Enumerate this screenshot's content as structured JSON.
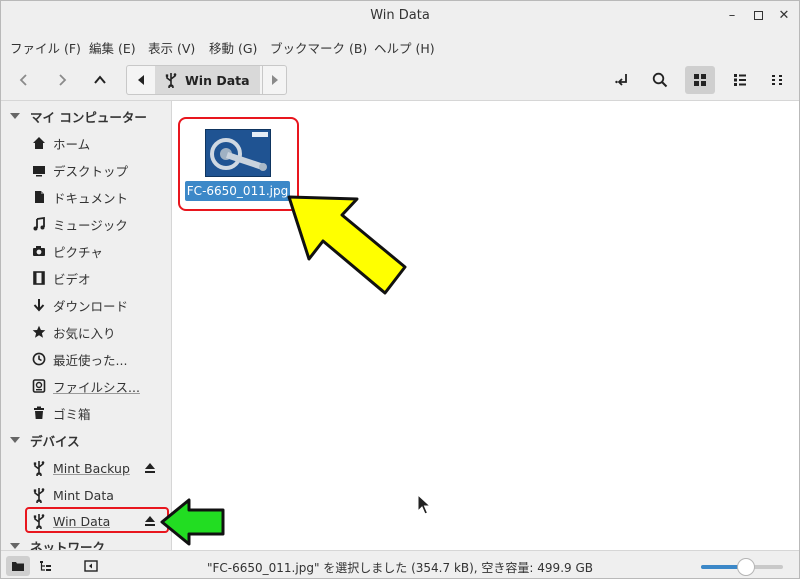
{
  "window": {
    "title": "Win Data"
  },
  "menubar": {
    "items": [
      "ファイル (F)",
      "編集 (E)",
      "表示 (V)",
      "移動 (G)",
      "ブックマーク (B)",
      "ヘルプ (H)"
    ]
  },
  "toolbar": {
    "path": {
      "current": "Win Data"
    }
  },
  "sidebar": {
    "sections": [
      {
        "title": "マイ コンピューター"
      },
      {
        "title": "デバイス"
      },
      {
        "title": "ネットワーク"
      }
    ],
    "places": [
      {
        "label": "ホーム",
        "icon": "home-icon"
      },
      {
        "label": "デスクトップ",
        "icon": "desktop-icon"
      },
      {
        "label": "ドキュメント",
        "icon": "document-icon"
      },
      {
        "label": "ミュージック",
        "icon": "music-icon"
      },
      {
        "label": "ピクチャ",
        "icon": "camera-icon"
      },
      {
        "label": "ビデオ",
        "icon": "video-icon"
      },
      {
        "label": "ダウンロード",
        "icon": "download-icon"
      },
      {
        "label": "お気に入り",
        "icon": "star-icon"
      },
      {
        "label": "最近使った...",
        "icon": "clock-icon"
      },
      {
        "label": "ファイルシス...",
        "icon": "drive-icon"
      },
      {
        "label": "ゴミ箱",
        "icon": "trash-icon"
      }
    ],
    "devices": [
      {
        "label": "Mint Backup",
        "icon": "usb-icon",
        "eject": true
      },
      {
        "label": "Mint Data",
        "icon": "usb-icon",
        "eject": false
      },
      {
        "label": "Win Data",
        "icon": "usb-icon",
        "eject": true
      }
    ]
  },
  "content": {
    "files": [
      {
        "name": "FC-6650_011.jpg",
        "selected": true
      }
    ]
  },
  "statusbar": {
    "text": "\"FC-6650_011.jpg\" を選択しました (354.7 kB), 空き容量: 499.9 GB",
    "zoom": 0.55
  },
  "colors": {
    "selection": "#3c88c8",
    "highlight_box": "#e8161e",
    "yellow_arrow": "#ffff00",
    "green_arrow": "#22dd22"
  }
}
